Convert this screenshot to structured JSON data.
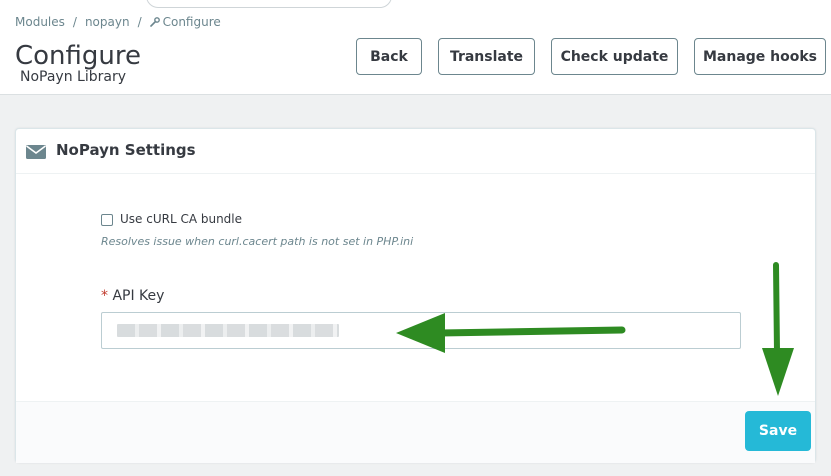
{
  "breadcrumb": {
    "items": [
      "Modules",
      "nopayn",
      "Configure"
    ],
    "separator": "/"
  },
  "header": {
    "title": "Configure",
    "subtitle": "NoPayn Library"
  },
  "toolbar": {
    "back_label": "Back",
    "translate_label": "Translate",
    "check_update_label": "Check update",
    "manage_hooks_label": "Manage hooks"
  },
  "panel": {
    "title": "NoPayn Settings",
    "icon": "envelope-icon",
    "curl_checkbox": {
      "label": "Use cURL CA bundle",
      "checked": false,
      "help": "Resolves issue when curl.cacert path is not set in PHP.ini"
    },
    "api_key": {
      "required_mark": "*",
      "label": "API Key",
      "value_obscured": true
    },
    "save_label": "Save"
  },
  "colors": {
    "accent": "#25b9d7",
    "annotation_arrow": "#2e8b22",
    "required": "#c0392b",
    "background": "#eff1f2"
  }
}
